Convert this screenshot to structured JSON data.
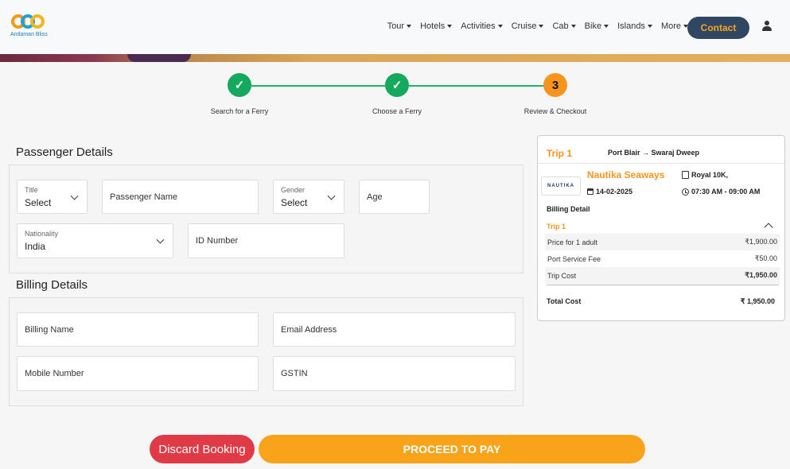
{
  "header": {
    "logo_text": "Andaman Bliss",
    "nav": [
      "Tour",
      "Hotels",
      "Activities",
      "Cruise",
      "Cab",
      "Bike",
      "Islands",
      "More"
    ],
    "contact_label": "Contact"
  },
  "steps": [
    {
      "label": "Search for a Ferry",
      "status": "done",
      "mark": "✓"
    },
    {
      "label": "Choose a Ferry",
      "status": "done",
      "mark": "✓"
    },
    {
      "label": "Review & Checkout",
      "status": "current",
      "mark": "3"
    }
  ],
  "passenger": {
    "section_title": "Passenger Details",
    "title_label": "Title",
    "title_value": "Select",
    "name_placeholder": "Passenger Name",
    "gender_label": "Gender",
    "gender_value": "Select",
    "age_placeholder": "Age",
    "nationality_label": "Nationality",
    "nationality_value": "India",
    "id_placeholder": "ID Number"
  },
  "billing": {
    "section_title": "Billing Details",
    "name_placeholder": "Billing Name",
    "email_placeholder": "Email Address",
    "mobile_placeholder": "Mobile Number",
    "gstin_placeholder": "GSTIN"
  },
  "summary": {
    "trip_label": "Trip 1",
    "route": "Port Blair → Swaraj Dweep",
    "ferry_logo_text": "NAUTIKA",
    "ferry_name": "Nautika Seaways",
    "vessel": "Royal 10K,",
    "date": "14-02-2025",
    "time": "07:30 AM - 09:00 AM",
    "billing_detail_label": "Billing Detail",
    "trip_sub_label": "Trip 1",
    "rows": [
      {
        "label": "Price for 1 adult",
        "value": "₹1,900.00"
      },
      {
        "label": "Port Service Fee",
        "value": "₹50.00"
      },
      {
        "label": "Trip Cost",
        "value": "₹1,950.00"
      }
    ],
    "total_label": "Total Cost",
    "total_value": "₹ 1,950.00"
  },
  "actions": {
    "discard_label": "Discard Booking",
    "pay_label": "PROCEED TO PAY"
  },
  "colors": {
    "accent": "#f7941d",
    "success": "#15a95e",
    "danger": "#e03a47",
    "navy": "#2f4763"
  }
}
